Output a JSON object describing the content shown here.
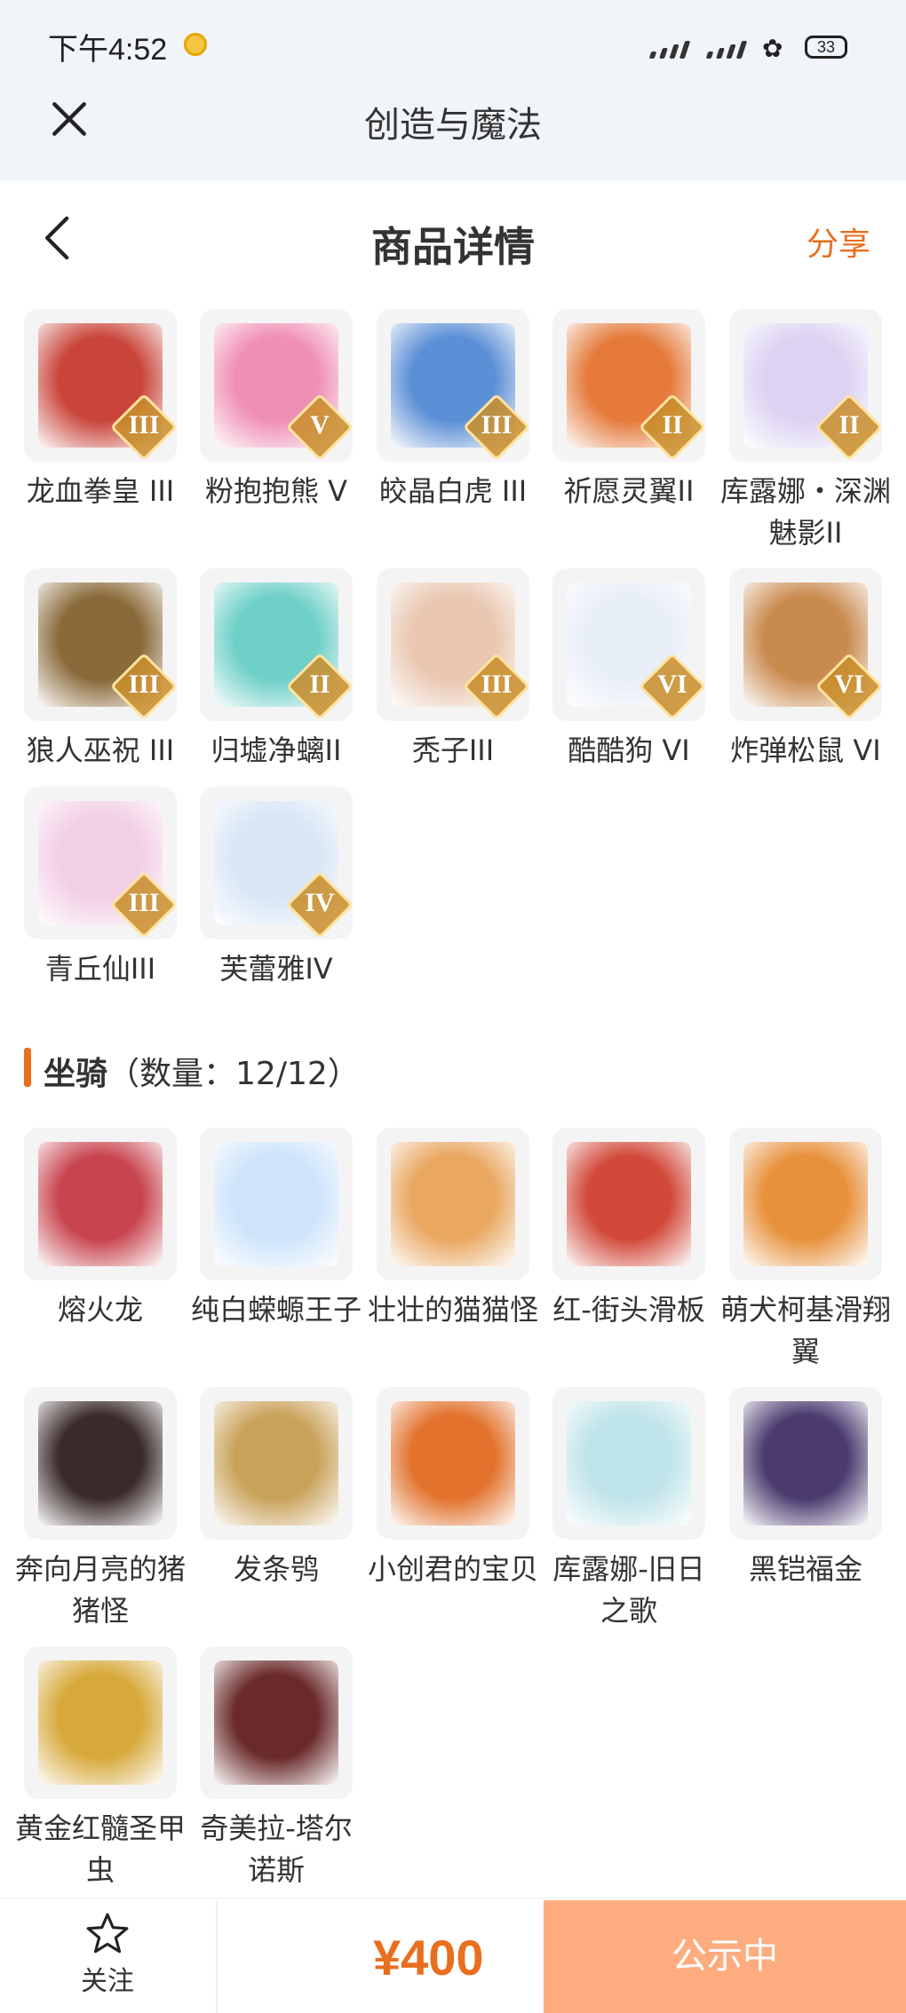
{
  "status_bar": {
    "time": "下午4:52",
    "battery": "33"
  },
  "top_bar": {
    "title": "创造与魔法"
  },
  "nav_bar": {
    "title": "商品详情",
    "share_label": "分享"
  },
  "skins": [
    {
      "name": "龙血拳皇 III",
      "rank": "III",
      "color": "#c9453a"
    },
    {
      "name": "粉抱抱熊 V",
      "rank": "V",
      "color": "#f08fb5"
    },
    {
      "name": "皎晶白虎 III",
      "rank": "III",
      "color": "#5b8fd6"
    },
    {
      "name": "祈愿灵翼II",
      "rank": "II",
      "color": "#e57a3a"
    },
    {
      "name": "库露娜・深渊魅影II",
      "rank": "II",
      "color": "#dcd3f2"
    },
    {
      "name": "狼人巫祝 III",
      "rank": "III",
      "color": "#8a6a3a"
    },
    {
      "name": "归墟净螭II",
      "rank": "II",
      "color": "#6fd0c8"
    },
    {
      "name": "秃子III",
      "rank": "III",
      "color": "#e9c7b0"
    },
    {
      "name": "酷酷狗 VI",
      "rank": "VI",
      "color": "#e8eef8"
    },
    {
      "name": "炸弹松鼠 VI",
      "rank": "VI",
      "color": "#c98a4e"
    },
    {
      "name": "青丘仙III",
      "rank": "III",
      "color": "#f3cfe6"
    },
    {
      "name": "芙蕾雅IV",
      "rank": "IV",
      "color": "#d8e6f6"
    }
  ],
  "mounts_section": {
    "title": "坐骑",
    "count_label": "（数量：12/12）"
  },
  "mounts": [
    {
      "name": "熔火龙",
      "color": "#c8444f"
    },
    {
      "name": "纯白蝾螈王子",
      "color": "#cde4fb"
    },
    {
      "name": "壮壮的猫猫怪",
      "color": "#e9a760"
    },
    {
      "name": "红-街头滑板",
      "color": "#d2493a"
    },
    {
      "name": "萌犬柯基滑翔翼",
      "color": "#e8913c"
    },
    {
      "name": "奔向月亮的猪猪怪",
      "color": "#3a2a2a"
    },
    {
      "name": "发条鸮",
      "color": "#c9a25a"
    },
    {
      "name": "小创君的宝贝",
      "color": "#e2722c"
    },
    {
      "name": "库露娜-旧日之歌",
      "color": "#bfe4ea"
    },
    {
      "name": "黑铠福金",
      "color": "#4a3a6e"
    },
    {
      "name": "黄金红髓圣甲虫",
      "color": "#d7a93a"
    },
    {
      "name": "奇美拉-塔尔诺斯",
      "color": "#6a2a2a"
    }
  ],
  "footer": {
    "follow_label": "关注",
    "price": "¥400",
    "status_label": "公示中"
  }
}
